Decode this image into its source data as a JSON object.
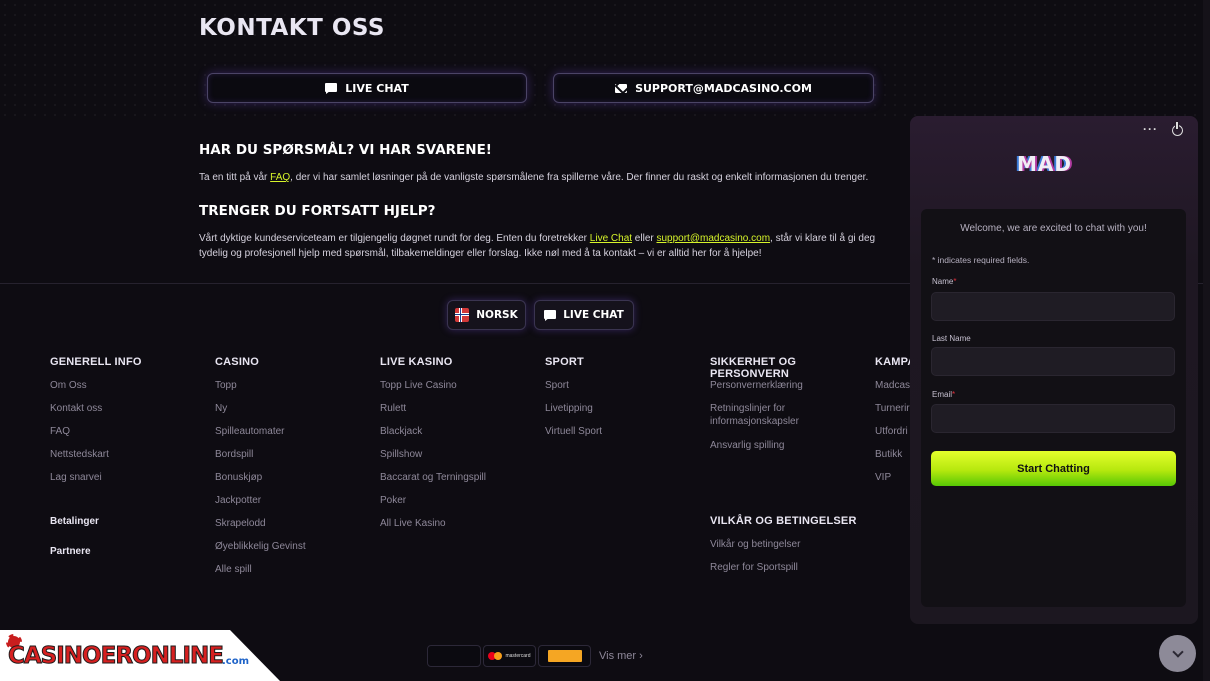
{
  "contact": {
    "title": "KONTAKT OSS",
    "live_chat_label": "LIVE CHAT",
    "email_label": "SUPPORT@MADCASINO.COM"
  },
  "faq": {
    "heading": "HAR DU SPØRSMÅL? VI HAR SVARENE!",
    "text_before": "Ta en titt på vår ",
    "link": "FAQ",
    "text_after": ", der vi har samlet løsninger på de vanligste spørsmålene fra spillerne våre. Der finner du raskt og enkelt informasjonen du trenger."
  },
  "help": {
    "heading": "TRENGER DU FORTSATT HJELP?",
    "text_1": "Vårt dyktige kundeserviceteam er tilgjengelig døgnet rundt for deg. Enten du foretrekker ",
    "link_chat": "Live Chat",
    "text_2": " eller ",
    "link_email": "support@madcasino.com",
    "text_3": ", står vi klare til å gi deg tydelig og profesjonell hjelp med spørsmål, tilbakemeldinger eller forslag. Ikke nøl med å ta kontakt – vi er alltid her for å hjelpe!"
  },
  "footer_bar": {
    "language": "NORSK",
    "live_chat": "LIVE CHAT"
  },
  "columns": [
    {
      "heading": "GENERELL INFO",
      "links": [
        "Om Oss",
        "Kontakt oss",
        "FAQ",
        "Nettstedskart",
        "Lag snarvei"
      ]
    },
    {
      "heading": "CASINO",
      "links": [
        "Topp",
        "Ny",
        "Spilleautomater",
        "Bordspill",
        "Bonuskjøp",
        "Jackpotter",
        "Skrapelodd",
        "Øyeblikkelig Gevinst",
        "Alle spill"
      ]
    },
    {
      "heading": "LIVE KASINO",
      "links": [
        "Topp Live Casino",
        "Rulett",
        "Blackjack",
        "Spillshow",
        "Baccarat og Terningspill",
        "Poker",
        "All Live Kasino"
      ]
    },
    {
      "heading": "SPORT",
      "links": [
        "Sport",
        "Livetipping",
        "Virtuell Sport"
      ]
    },
    {
      "heading": "SIKKERHET OG PERSONVERN",
      "links": [
        "Personvernerklæring",
        "Retningslinjer for informasjonskapsler",
        "Ansvarlig spilling"
      ]
    },
    {
      "heading": "KAMPA",
      "links": [
        "Madcas",
        "Turnerir",
        "Utfordri",
        "Butikk",
        "VIP"
      ]
    }
  ],
  "extra_links": {
    "betalinger": "Betalinger",
    "partnere": "Partnere"
  },
  "terms": {
    "heading": "VILKÅR OG BETINGELSER",
    "links": [
      "Vilkår og betingelser",
      "Regler for Sportspill"
    ]
  },
  "payments": {
    "mastercard": "mastercard",
    "more": "Vis mer"
  },
  "watermark": {
    "text": "CASINOERONLINE",
    "suffix": ".com"
  },
  "chat": {
    "brand": "MAD",
    "menu_icon": "ellipsis-icon",
    "welcome": "Welcome, we are excited to chat with you!",
    "required_note": "* indicates required fields.",
    "name_label": "Name",
    "last_name_label": "Last Name",
    "email_label": "Email",
    "required_mark": "*",
    "start_button": "Start Chatting"
  },
  "colors": {
    "accent": "#d7f52a",
    "background": "#0e0c12",
    "start_button": "#c6f01a"
  }
}
